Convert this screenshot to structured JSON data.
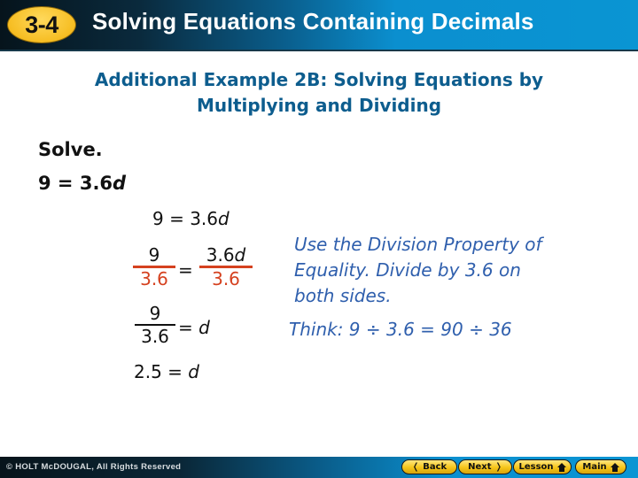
{
  "header": {
    "lesson_badge": "3-4",
    "title": "Solving Equations Containing Decimals"
  },
  "subtitle": {
    "line1": "Additional Example 2B: Solving Equations by",
    "line2": "Multiplying and Dividing"
  },
  "problem": {
    "instruction": "Solve.",
    "equation_lhs": "9 = 3.6",
    "equation_var": "d"
  },
  "steps": {
    "step1": {
      "lhs": "9 = 3.6",
      "var": "d"
    },
    "step2": {
      "left_num": "9",
      "left_den": "3.6",
      "equals": "=",
      "right_num": "3.6",
      "right_var": "d",
      "right_den": "3.6"
    },
    "step3": {
      "num": "9",
      "den": "3.6",
      "equals": "= ",
      "var": "d"
    },
    "step4": {
      "lhs": "2.5 = ",
      "var": "d"
    }
  },
  "notes": {
    "line1": "Use the Division Property of",
    "line2": "Equality. Divide by 3.6 on",
    "line3": "both sides.",
    "think": "Think: 9 ÷ 3.6 = 90 ÷ 36"
  },
  "colors": {
    "subtitle": "#0d5d8e",
    "notes": "#2f5fad",
    "divisor": "#d5411f",
    "badge": "#f6bd22"
  },
  "footer": {
    "copyright": "© HOLT McDOUGAL, All Rights Reserved",
    "buttons": {
      "back": "Back",
      "next": "Next",
      "lesson": "Lesson",
      "main": "Main"
    },
    "icons": {
      "back": "chevron-left-icon",
      "next": "chevron-right-icon",
      "lesson": "home-icon",
      "main": "home-icon"
    }
  }
}
